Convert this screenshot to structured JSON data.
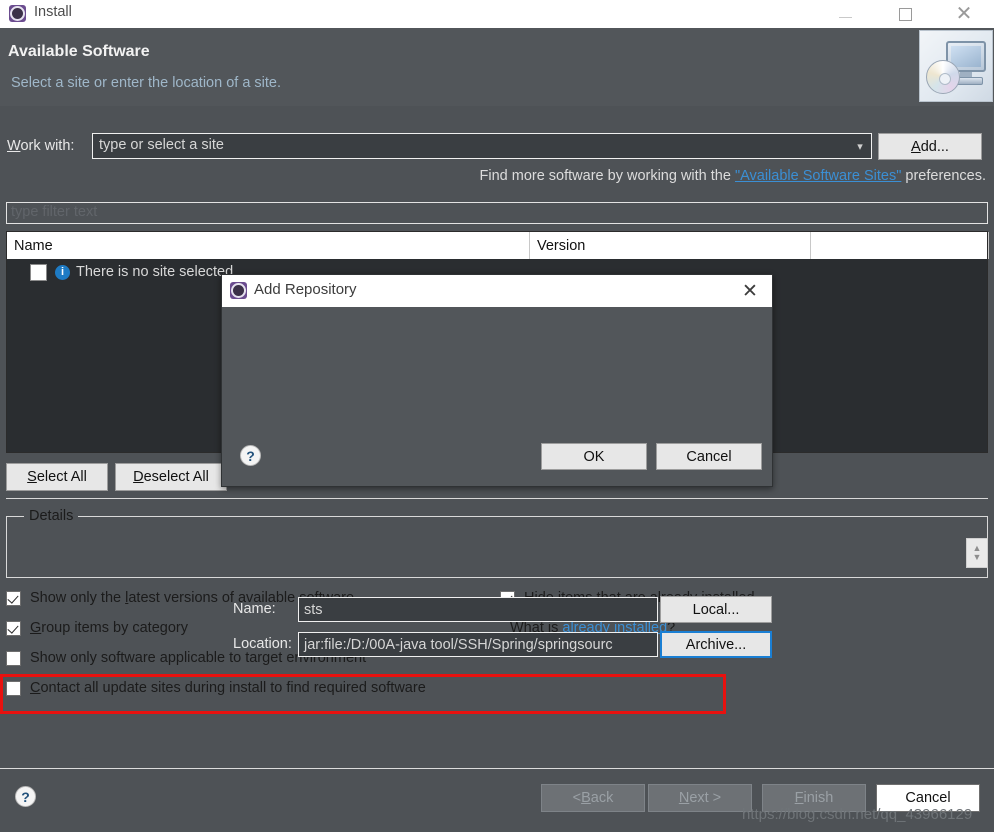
{
  "window": {
    "title": "Install",
    "icon": "gear-icon",
    "controls": {
      "minimize": "minimize-icon",
      "maximize": "maximize-icon",
      "close": "close-icon"
    }
  },
  "header": {
    "title": "Available Software",
    "subtitle": "Select a site or enter the location of a site.",
    "icon": "computer-cd-icon"
  },
  "workwith": {
    "label": "Work with:",
    "placeholder": "type or select a site",
    "value": "",
    "dropdown_icon": "chevron-down-icon",
    "add_label": "Add..."
  },
  "findmore": {
    "prefix": "Find more software by working with the ",
    "link": "\"Available Software Sites\"",
    "suffix": " preferences."
  },
  "filter": {
    "placeholder": "type filter text",
    "value": ""
  },
  "table": {
    "columns": [
      "Name",
      "Version",
      ""
    ],
    "rows": [
      {
        "checked": false,
        "icon": "info-icon",
        "name": "There is no site selected.",
        "version": ""
      }
    ]
  },
  "selection": {
    "select_all": "Select All",
    "deselect_all": "Deselect All"
  },
  "details": {
    "legend": "Details",
    "content": "",
    "spinner_icon": "spinner-updown-icon"
  },
  "options": {
    "latest_versions": {
      "label": "Show only the latest versions of available software",
      "checked": true
    },
    "group_by_category": {
      "label": "Group items by category",
      "checked": true
    },
    "target_environment": {
      "label": "Show only software applicable to target environment",
      "checked": false
    },
    "contact_all_sites": {
      "label": "Contact all update sites during install to find required software",
      "checked": false
    },
    "hide_installed": {
      "label": "Hide items that are already installed",
      "checked": true
    },
    "whatis_prefix": "What is ",
    "whatis_link": "already installed",
    "whatis_suffix": "?"
  },
  "wizard_buttons": {
    "back": "< Back",
    "next": "Next >",
    "finish": "Finish",
    "cancel": "Cancel",
    "help_icon": "help-icon"
  },
  "modal": {
    "title": "Add Repository",
    "icon": "gear-icon",
    "close_icon": "close-icon",
    "name_label": "Name:",
    "name_value": "sts",
    "location_label": "Location:",
    "location_value": "jar:file:/D:/00A-java tool/SSH/Spring/springsourc",
    "local_label": "Local...",
    "archive_label": "Archive...",
    "ok_label": "OK",
    "cancel_label": "Cancel",
    "help_icon": "help-icon"
  },
  "annotation": {
    "highlight_color": "#e8110f"
  },
  "watermark": "https://blog.csdn.net/qq_43966129"
}
